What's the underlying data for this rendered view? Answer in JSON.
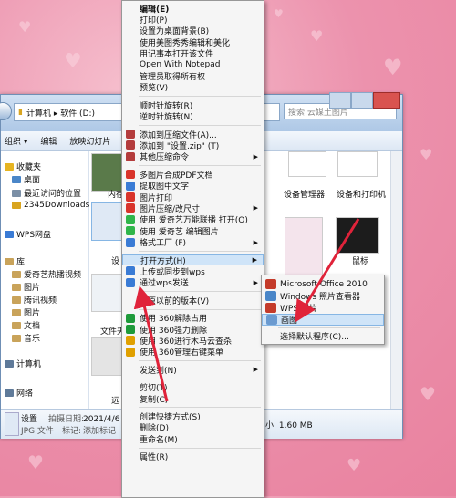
{
  "explorer": {
    "address_path": "计算机 ▸ 软件 (D:)",
    "search_placeholder": "搜索 云媒土图片",
    "toolbar": {
      "organize": "组织 ▾",
      "edit": "编辑",
      "slideshow": "放映幻灯片"
    },
    "nav": {
      "favorites": "收藏夹",
      "desktop": "桌面",
      "recent": "最近访问的位置",
      "downloads": "2345Downloads",
      "wps": "WPS网盘",
      "library": "库",
      "aiqiyi": "爱奇艺热播视频",
      "images": "图片",
      "tencent": "腾讯视频",
      "pictures": "图片",
      "docs": "文档",
      "music": "音乐",
      "computer": "计算机",
      "network": "网络"
    },
    "items": {
      "memory": "内存",
      "devices": "设备管理器",
      "devices_printers": "设备和打印机",
      "mouse": "鼠标",
      "settings_partial": "设",
      "folder_options": "文件夹",
      "remote": "远"
    },
    "details": {
      "name": "设置",
      "type": "JPG 文件",
      "date_label": "拍摄日期:",
      "date_value": "2021/4/6 星期...",
      "tag_label": "标记:",
      "tag_value": "添加标记",
      "size": "小: 1.60 MB"
    }
  },
  "context_menu": {
    "items": [
      {
        "label": "编辑(E)",
        "bold": true
      },
      {
        "label": "打印(P)"
      },
      {
        "label": "设置为桌面背景(B)"
      },
      {
        "label": "使用美图秀秀编辑和美化"
      },
      {
        "label": "用记事本打开该文件"
      },
      {
        "label": "Open With Notepad"
      },
      {
        "label": "管理员取得所有权"
      },
      {
        "label": "预览(V)"
      },
      {
        "sep": true
      },
      {
        "label": "顺时针旋转(R)"
      },
      {
        "label": "逆时针旋转(N)"
      },
      {
        "sep": true
      },
      {
        "label": "添加到压缩文件(A)...",
        "icon": "#b43c3c"
      },
      {
        "label": "添加到 \"设置.zip\" (T)",
        "icon": "#b43c3c"
      },
      {
        "label": "其他压缩命令",
        "icon": "#b43c3c",
        "arrow": true
      },
      {
        "sep": true
      },
      {
        "label": "多图片合成PDF文档",
        "icon": "#d9342b"
      },
      {
        "label": "提取图中文字",
        "icon": "#3a7bd5"
      },
      {
        "label": "图片打印",
        "icon": "#d9342b"
      },
      {
        "label": "图片压缩/改尺寸",
        "icon": "#d9342b",
        "arrow": true
      },
      {
        "label": "使用 爱奇艺万能联播 打开(O)",
        "icon": "#2fb54a"
      },
      {
        "label": "使用 爱奇艺 编辑图片",
        "icon": "#2fb54a"
      },
      {
        "label": "格式工厂 (F)",
        "icon": "#3a7bd5",
        "arrow": true
      },
      {
        "sep": true
      },
      {
        "label": "打开方式(H)",
        "arrow": true,
        "highlight": true
      },
      {
        "label": "上传或同步到wps",
        "icon": "#3a7bd5"
      },
      {
        "label": "通过wps发送",
        "icon": "#3a7bd5",
        "arrow": true
      },
      {
        "sep": true
      },
      {
        "label": "还原以前的版本(V)"
      },
      {
        "sep": true
      },
      {
        "label": "使用 360解除占用",
        "icon": "#1e9a3a"
      },
      {
        "label": "使用 360强力删除",
        "icon": "#1e9a3a"
      },
      {
        "label": "使用 360进行木马云查杀",
        "icon": "#e0a000"
      },
      {
        "label": "使用 360管理右键菜单",
        "icon": "#e0a000"
      },
      {
        "sep": true
      },
      {
        "label": "发送到(N)",
        "arrow": true
      },
      {
        "sep": true
      },
      {
        "label": "剪切(T)"
      },
      {
        "label": "复制(C)"
      },
      {
        "sep": true
      },
      {
        "label": "创建快捷方式(S)"
      },
      {
        "label": "删除(D)"
      },
      {
        "label": "重命名(M)"
      },
      {
        "sep": true
      },
      {
        "label": "属性(R)"
      }
    ]
  },
  "open_with_submenu": {
    "items": [
      {
        "label": "Microsoft Office 2010",
        "icon": "#c43b2a"
      },
      {
        "label": "Windows 照片查看器",
        "icon": "#4a86c8"
      },
      {
        "label": "WPS 图片",
        "icon": "#c43b2a"
      },
      {
        "label": "画图",
        "icon": "#6a9ad0",
        "highlight": true
      },
      {
        "sep": true
      },
      {
        "label": "选择默认程序(C)..."
      }
    ]
  },
  "colors": {
    "arrow": "#e0233a",
    "highlight": "#cfe4f8",
    "background": "#ec92ad"
  }
}
